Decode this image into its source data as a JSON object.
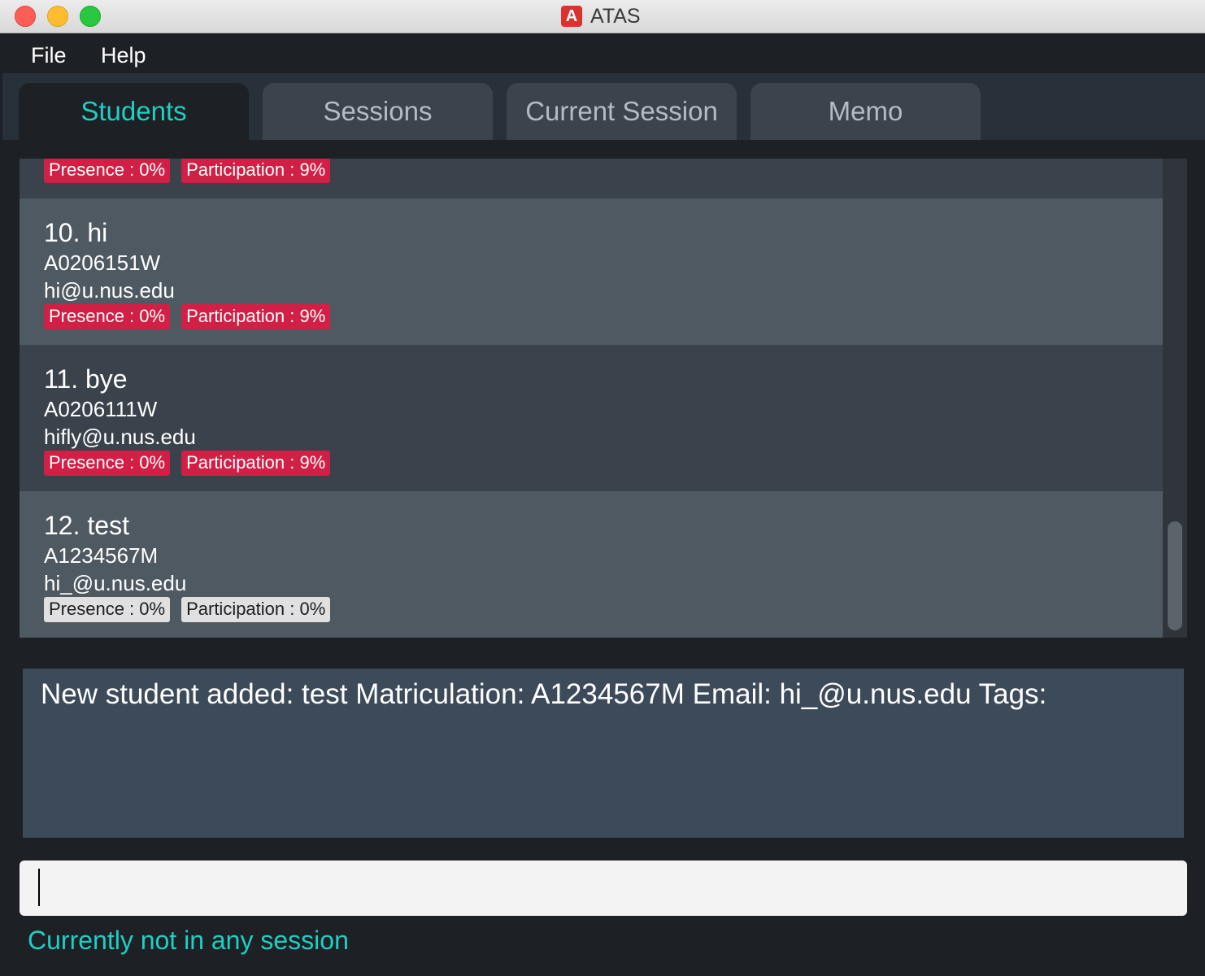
{
  "window": {
    "title": "ATAS",
    "icon_letter": "A"
  },
  "menu": {
    "file": "File",
    "help": "Help"
  },
  "tabs": [
    "Students",
    "Sessions",
    "Current Session",
    "Memo"
  ],
  "students": [
    {
      "presence": "Presence : 0%",
      "participation": "Participation : 9%",
      "tag_color": "#d21f45"
    },
    {
      "name": "10.  hi",
      "matric": "A0206151W",
      "email": "hi@u.nus.edu",
      "presence": "Presence : 0%",
      "participation": "Participation : 9%",
      "tag_color": "#d21f45"
    },
    {
      "name": "11.  bye",
      "matric": "A0206111W",
      "email": "hifly@u.nus.edu",
      "presence": "Presence : 0%",
      "participation": "Participation : 9%",
      "tag_color": "#d21f45"
    },
    {
      "name": "12.  test",
      "matric": "A1234567M",
      "email": "hi_@u.nus.edu",
      "presence": "Presence : 0%",
      "participation": "Participation : 0%",
      "tag_color": "#e0e0e0"
    }
  ],
  "result": {
    "text": "New student added: test Matriculation: A1234567M Email: hi_@u.nus.edu Tags:"
  },
  "command": {
    "value": "",
    "placeholder": ""
  },
  "status": {
    "text": "Currently not in any session"
  },
  "colors": {
    "accent": "#1ecfc4",
    "tag_red": "#d21f45",
    "tag_grey": "#e0e0e0"
  }
}
